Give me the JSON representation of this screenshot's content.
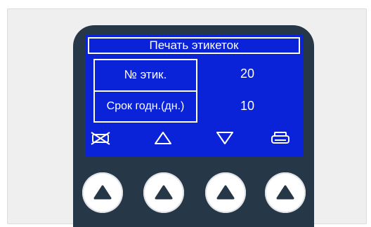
{
  "screen": {
    "title": "Печать этикеток",
    "rows": [
      {
        "label": "№ этик.",
        "value": "20"
      },
      {
        "label": "Срок годн.(дн.)",
        "value": "10"
      }
    ]
  },
  "softkeys": [
    {
      "icon": "cancel-icon"
    },
    {
      "icon": "arrow-up-outline-icon"
    },
    {
      "icon": "arrow-down-outline-icon"
    },
    {
      "icon": "printer-icon"
    }
  ],
  "buttons": [
    {
      "icon": "triangle-up-icon"
    },
    {
      "icon": "triangle-up-icon"
    },
    {
      "icon": "triangle-up-icon"
    },
    {
      "icon": "triangle-up-icon"
    }
  ],
  "colors": {
    "screen_background": "#0a22d8",
    "screen_text": "#ffffff",
    "device_body": "#263748",
    "button_face": "#ffffff",
    "button_arrow": "#263748"
  }
}
